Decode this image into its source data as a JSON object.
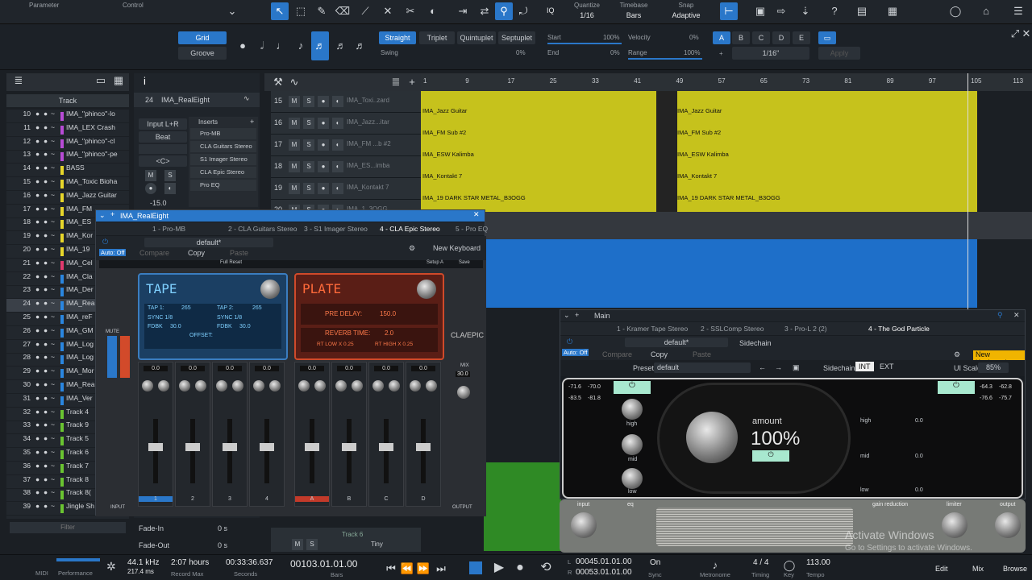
{
  "topbar": {
    "parameter": "Parameter",
    "control": "Control",
    "quantize_label": "Quantize",
    "quantize": "1/16",
    "timebase_label": "Timebase",
    "timebase": "Bars",
    "snap_label": "Snap",
    "snap": "Adaptive",
    "iq": "IQ"
  },
  "quant": {
    "grid": "Grid",
    "groove": "Groove",
    "straight": "Straight",
    "triplet": "Triplet",
    "quintuplet": "Quintuplet",
    "septuplet": "Septuplet",
    "swing": "Swing",
    "swing_val": "0%",
    "start": "Start",
    "start_val": "100%",
    "end": "End",
    "end_val": "0%",
    "velocity": "Velocity",
    "velocity_val": "0%",
    "range": "Range",
    "range_val": "100%",
    "letters": [
      "A",
      "B",
      "C",
      "D",
      "E"
    ],
    "plus": "+",
    "div": "1/16\"",
    "apply": "Apply"
  },
  "tracks": {
    "header": "Track",
    "filter": "Filter",
    "rows": [
      {
        "n": "10",
        "t": "IMA_''phinco''-lo",
        "c": "#b84bd6"
      },
      {
        "n": "11",
        "t": "IMA_LEX Crash",
        "c": "#b84bd6"
      },
      {
        "n": "12",
        "t": "IMA_''phinco''-cl",
        "c": "#b84bd6"
      },
      {
        "n": "13",
        "t": "IMA_''phinco''-pe",
        "c": "#b84bd6"
      },
      {
        "n": "14",
        "t": "BASS",
        "c": "#e8d72a"
      },
      {
        "n": "15",
        "t": "IMA_Toxic Bioha",
        "c": "#e8d72a"
      },
      {
        "n": "16",
        "t": "IMA_Jazz Guitar",
        "c": "#e8d72a"
      },
      {
        "n": "17",
        "t": "IMA_FM",
        "c": "#e8d72a"
      },
      {
        "n": "18",
        "t": "IMA_ES",
        "c": "#e8d72a"
      },
      {
        "n": "19",
        "t": "IMA_Kor",
        "c": "#e8d72a"
      },
      {
        "n": "20",
        "t": "IMA_19",
        "c": "#e8d72a"
      },
      {
        "n": "21",
        "t": "IMA_Cel",
        "c": "#e23a6e"
      },
      {
        "n": "22",
        "t": "IMA_Cla",
        "c": "#2a86e0"
      },
      {
        "n": "23",
        "t": "IMA_Der",
        "c": "#2a86e0"
      },
      {
        "n": "24",
        "t": "IMA_Rea",
        "c": "#2a86e0"
      },
      {
        "n": "25",
        "t": "IMA_reF",
        "c": "#2a86e0"
      },
      {
        "n": "26",
        "t": "IMA_GM",
        "c": "#2a86e0"
      },
      {
        "n": "27",
        "t": "IMA_Log",
        "c": "#2a86e0"
      },
      {
        "n": "28",
        "t": "IMA_Log",
        "c": "#2a86e0"
      },
      {
        "n": "29",
        "t": "IMA_Mor",
        "c": "#2a86e0"
      },
      {
        "n": "30",
        "t": "IMA_Rea",
        "c": "#2a86e0"
      },
      {
        "n": "31",
        "t": "IMA_Ver",
        "c": "#2a86e0"
      },
      {
        "n": "32",
        "t": "Track 4",
        "c": "#6ac431"
      },
      {
        "n": "33",
        "t": "Track 9",
        "c": "#6ac431"
      },
      {
        "n": "34",
        "t": "Track 5",
        "c": "#6ac431"
      },
      {
        "n": "35",
        "t": "Track 6",
        "c": "#6ac431"
      },
      {
        "n": "36",
        "t": "Track 7",
        "c": "#6ac431"
      },
      {
        "n": "37",
        "t": "Track 8",
        "c": "#6ac431"
      },
      {
        "n": "38",
        "t": "Track 8(",
        "c": "#6ac431"
      },
      {
        "n": "39",
        "t": "Jingle Sh",
        "c": "#6ac431"
      }
    ]
  },
  "inspector": {
    "num": "24",
    "name": "IMA_RealEight",
    "input": "Input L+R",
    "beat": "Beat",
    "center": "<C>",
    "vol": "-15.0",
    "inserts": "Inserts",
    "plugins": [
      "Pro-MB",
      "CLA Guitars Stereo",
      "S1 Imager Stereo",
      "CLA Epic Stereo",
      "Pro EQ"
    ],
    "fade_in": "Fade-In",
    "fade_out": "Fade-Out",
    "fade_in_val": "0 s",
    "fade_out_val": "0 s",
    "tiny": "Tiny"
  },
  "arrange": {
    "rows": [
      {
        "n": "15",
        "name": "IMA_Toxi..zard"
      },
      {
        "n": "16",
        "name": "IMA_Jazz...itar"
      },
      {
        "n": "17",
        "name": "IMA_FM ...b #2"
      },
      {
        "n": "18",
        "name": "IMA_ES...imba"
      },
      {
        "n": "19",
        "name": "IMA_Kontakt 7"
      },
      {
        "n": "20",
        "name": "IMA_1..3OGG"
      }
    ],
    "ruler": [
      "1",
      "9",
      "17",
      "25",
      "33",
      "41",
      "49",
      "57",
      "65",
      "73",
      "81",
      "89",
      "97",
      "105",
      "113"
    ],
    "clips": [
      "IMA_Jazz Guitar",
      "IMA_FM Sub #2",
      "IMA_ESW Kalimba",
      "IMA_Kontakt 7",
      "IMA_19 DARK STAR METAL_B3OGG"
    ],
    "clips2": [
      "IMA_Jazz Guitar",
      "IMA_FM Sub #2",
      "IMA_ESW Kalimba",
      "IMA_Kontakt 7",
      "IMA_19 DARK STAR METAL_B3OGG"
    ],
    "track6": "Track 6"
  },
  "plugin1": {
    "title": "IMA_RealEight",
    "tabs": [
      "1 - Pro-MB",
      "2 - CLA Guitars Stereo",
      "3 - S1 Imager Stereo",
      "4 - CLA Epic Stereo",
      "5 - Pro EQ"
    ],
    "preset": "default*",
    "autooff": "Auto: Off",
    "compare": "Compare",
    "copy": "Copy",
    "paste": "Paste",
    "newkb": "New Keyboard",
    "tape": "TAPE",
    "plate": "PLATE",
    "tap1": "TAP 1:",
    "tap1v": "265",
    "tap2": "TAP 2:",
    "tap2v": "265",
    "sync": "SYNC 1/8",
    "feedback": "FDBK",
    "fbv": "30.0",
    "offset": "OFFSET:",
    "predelay": "PRE DELAY:",
    "predelayv": "150.0",
    "reverbtime": "REVERB TIME:",
    "reverbv": "2.0",
    "rtlow": "RT LOW X 0.25",
    "rthigh": "RT HIGH X 0.25",
    "mute": "MUTE",
    "mix": "MIX",
    "mixv": "30.0",
    "input": "INPUT",
    "output": "OUTPUT",
    "claepic": "CLA/EPIC",
    "chans": [
      "1",
      "2",
      "3",
      "4",
      "A",
      "B",
      "C",
      "D"
    ],
    "chvals": [
      "0.0",
      "0.0",
      "0.0",
      "0.0",
      "0.0",
      "0.0",
      "0.0",
      "0.0"
    ],
    "fullreset": "Full Reset",
    "setup": "Setup A",
    "save": "Save"
  },
  "plugin2": {
    "title": "Main",
    "tabs": [
      "1 - Kramer Tape Stereo",
      "2 - SSLComp Stereo",
      "3 - Pro-L 2 (2)",
      "4 - The God Particle"
    ],
    "preset_label": "Preset",
    "preset": "default",
    "sidechain": "Sidechain",
    "int": "INT",
    "ext": "EXT",
    "uiscale": "UI Scale",
    "uiscale_v": "85%",
    "autooff": "Auto: Off",
    "compare": "Compare",
    "copy": "Copy",
    "paste": "Paste",
    "newkb": "New Keyboard",
    "preset2": "default*",
    "inmeters": [
      "-71.6",
      "-70.0",
      "-83.5",
      "-81.8"
    ],
    "outmeters": [
      "-64.3",
      "-62.8",
      "-76.6",
      "-75.7"
    ],
    "amount": "amount",
    "amount_val": "100%",
    "high": "high",
    "mid": "mid",
    "low": "low",
    "zero": "0.0",
    "input": "input",
    "eq": "eq",
    "gainred": "gain reduction",
    "limiter": "limiter",
    "output": "output"
  },
  "status": {
    "midi": "MIDI",
    "performance": "Performance",
    "rate": "44.1 kHz",
    "latency": "217.4 ms",
    "hours": "2:07 hours",
    "recmax": "Record Max",
    "seconds_val": "00:33:36.637",
    "seconds": "Seconds",
    "bars_val": "00103.01.01.00",
    "bars": "Bars",
    "l": "00045.01.01.00",
    "r": "00053.01.01.00",
    "sync": "Sync",
    "sync_val": "On",
    "metronome": "Metronome",
    "timing": "Timing",
    "timing_val": "4 / 4",
    "key": "Key",
    "tempo": "Tempo",
    "tempo_val": "113.00",
    "edit": "Edit",
    "mix": "Mix",
    "browse": "Browse"
  },
  "activate": {
    "title": "Activate Windows",
    "sub": "Go to Settings to activate Windows."
  }
}
